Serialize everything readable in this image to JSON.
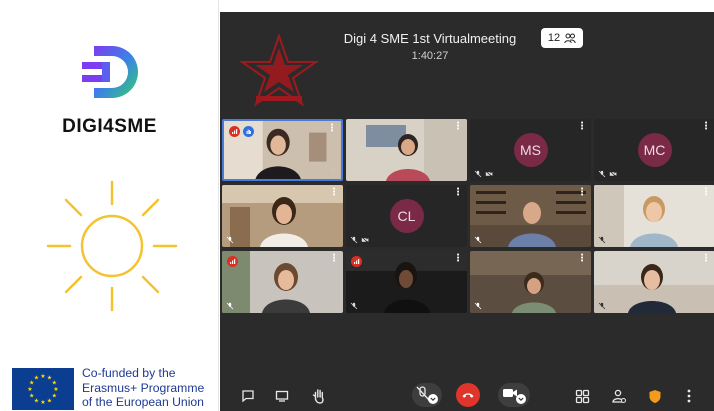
{
  "left_panel": {
    "logo_text": "DIGI4SME",
    "eu_text": [
      "Co-funded by the",
      "Erasmus+ Programme",
      "of the European Union"
    ]
  },
  "meeting": {
    "title": "Digi 4 SME 1st Virtualmeeting",
    "elapsed": "1:40:27",
    "participant_count": "12"
  },
  "tiles": [
    {
      "id": "t1",
      "kind": "video",
      "active": true,
      "badges": [
        "red-signal",
        "blue-hand"
      ],
      "star": true
    },
    {
      "id": "t2",
      "kind": "video"
    },
    {
      "id": "t3",
      "kind": "avatar",
      "initials": "MS"
    },
    {
      "id": "t4",
      "kind": "avatar",
      "initials": "MC"
    },
    {
      "id": "t5",
      "kind": "video"
    },
    {
      "id": "t6",
      "kind": "avatar",
      "initials": "CL"
    },
    {
      "id": "t7",
      "kind": "video"
    },
    {
      "id": "t8",
      "kind": "video"
    },
    {
      "id": "t9",
      "kind": "video",
      "badges": [
        "red-signal"
      ]
    },
    {
      "id": "t10",
      "kind": "video",
      "badges": [
        "red-signal"
      ]
    },
    {
      "id": "t11",
      "kind": "video"
    },
    {
      "id": "t12",
      "kind": "video"
    }
  ],
  "toolbar": {
    "icons": [
      "chat-icon",
      "screen-share-icon",
      "raise-hand-icon",
      "microphone-muted-icon",
      "hang-up-icon",
      "camera-icon",
      "tile-view-icon",
      "participants-icon",
      "security-shield-icon",
      "more-options-icon"
    ]
  },
  "colors": {
    "logo_gradient_start": "#7d3cf0",
    "logo_gradient_end": "#35d06a",
    "sun": "#f3c331",
    "eu_blue": "#0b3d91",
    "eu_text": "#1f3a93",
    "avatar_bg": "#7a2a46",
    "active_border": "#4a7bd8",
    "hangup_red": "#e0352b",
    "shield_orange": "#f39b1c"
  }
}
